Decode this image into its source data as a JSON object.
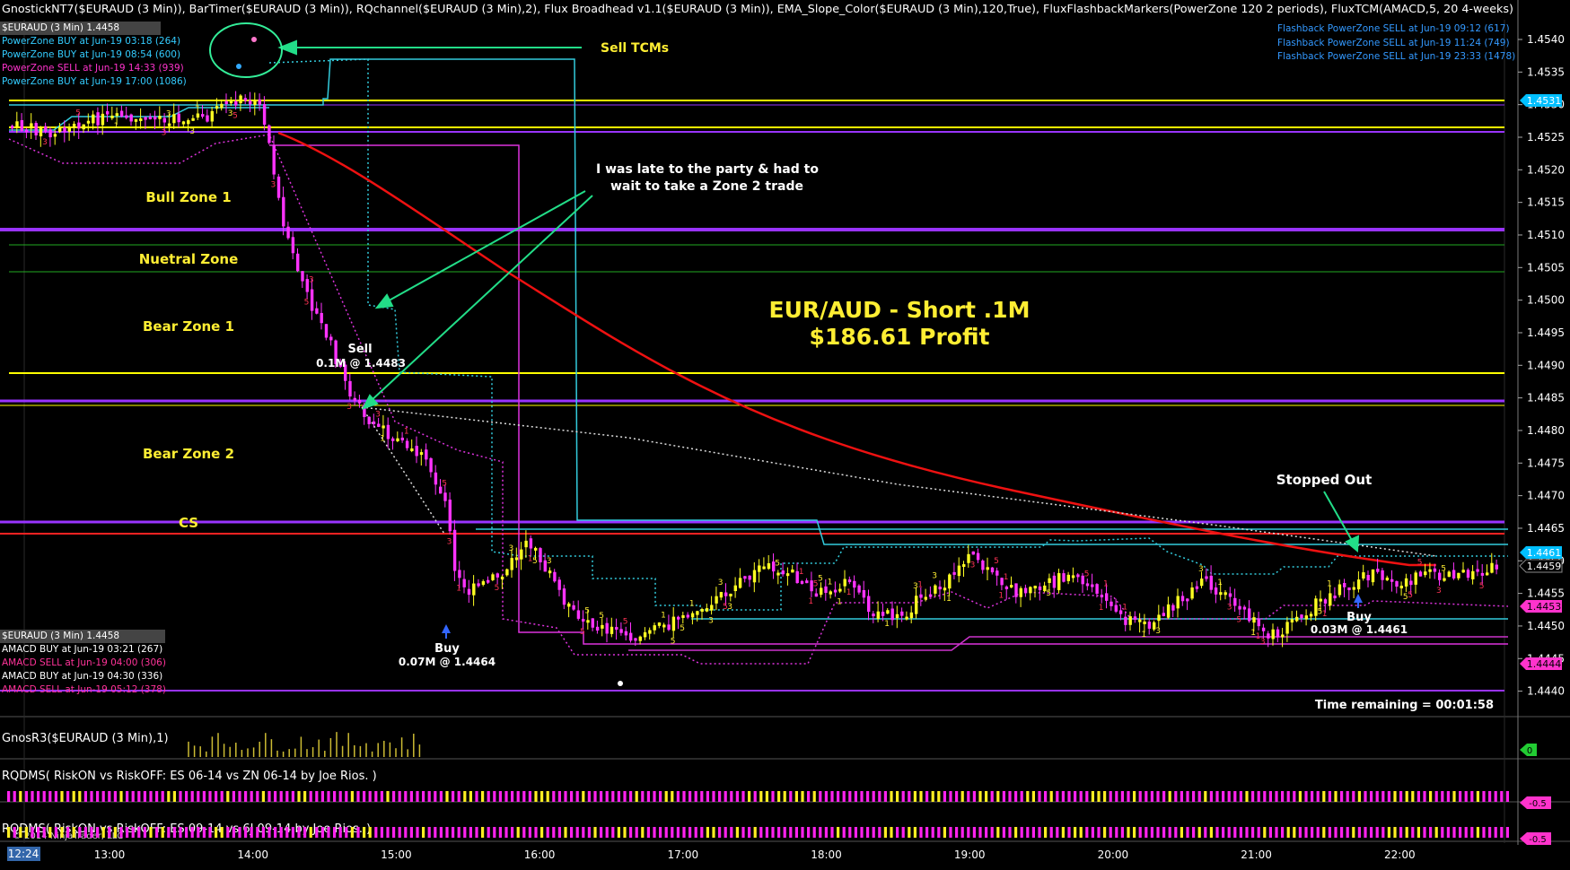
{
  "header": {
    "indicator_line": "GnostickNT7($EURAUD (3 Min)), BarTimer($EURAUD (3 Min)), RQchannel($EURAUD (3 Min),2), Flux Broadhead v1.1($EURAUD (3 Min)), EMA_Slope_Color($EURAUD (3 Min),120,True), FluxFlashbackMarkers(PowerZone 120 2 periods), FluxTCM(AMACD,5, 20 4-weeks)",
    "instrument": "$EURAUD (3 Min) 1.4458",
    "powerzone_entries": [
      {
        "text": "PowerZone BUY at Jun-19 03:18 (264)",
        "color": "#33ccff"
      },
      {
        "text": "PowerZone BUY at Jun-19 08:54 (600)",
        "color": "#33ccff"
      },
      {
        "text": "PowerZone SELL at Jun-19 14:33 (939)",
        "color": "#ff33cc"
      },
      {
        "text": "PowerZone BUY at Jun-19 17:00 (1086)",
        "color": "#33ccff"
      }
    ],
    "flashback_entries": [
      "Flashback PowerZone SELL at Jun-19 09:12 (617)",
      "Flashback PowerZone SELL at Jun-19 11:24 (749)",
      "Flashback PowerZone SELL at Jun-19 23:33 (1478)"
    ]
  },
  "lower_info": {
    "instrument": "$EURAUD (3 Min) 1.4458",
    "amacd_entries": [
      {
        "text": "AMACD BUY at Jun-19 03:21 (267)",
        "color": "#ffffff"
      },
      {
        "text": "AMACD SELL at Jun-19 04:00 (306)",
        "color": "#ff3399"
      },
      {
        "text": "AMACD BUY at Jun-19 04:30 (336)",
        "color": "#ffffff"
      },
      {
        "text": "AMACD SELL at Jun-19 05:12 (378)",
        "color": "#ff3399"
      }
    ]
  },
  "annotations": {
    "sell_tcms": "Sell TCMs",
    "late_line1": "I was late to the party & had to",
    "late_line2": "wait to take a Zone 2 trade",
    "title_line1": "EUR/AUD - Short .1M",
    "title_line2": "$186.61 Profit",
    "stopped_out": "Stopped Out",
    "sell_label": "Sell",
    "sell_detail": "0.1M @ 1.4483",
    "buy1_label": "Buy",
    "buy1_detail": "0.07M @ 1.4464",
    "buy2_label": "Buy",
    "buy2_detail": "0.03M @ 1.4461",
    "time_remaining": "Time remaining = 00:01:58",
    "copyright": "© 2014 NinjaTrader, LLC"
  },
  "zones": {
    "bull1": "Bull Zone 1",
    "neutral": "Nuetral Zone",
    "bear1": "Bear Zone 1",
    "bear2": "Bear Zone 2",
    "cs": "CS"
  },
  "price_axis": {
    "ticks": [
      "1.4540",
      "1.4535",
      "1.4530",
      "1.4525",
      "1.4520",
      "1.4515",
      "1.4510",
      "1.4505",
      "1.4500",
      "1.4495",
      "1.4490",
      "1.4485",
      "1.4480",
      "1.4475",
      "1.4470",
      "1.4465",
      "1.4460",
      "1.4455",
      "1.4450",
      "1.4445",
      "1.4440"
    ],
    "markers": [
      {
        "text": "1.4531",
        "bg": "#00bfff",
        "fg": "#ffffff"
      },
      {
        "text": "1.4461",
        "bg": "#00bfff",
        "fg": "#ffffff"
      },
      {
        "text": "1.4459",
        "bg": "#000000",
        "fg": "#ffffff"
      },
      {
        "text": "1.4453",
        "bg": "#ff33cc",
        "fg": "#000000"
      },
      {
        "text": "1.4444",
        "bg": "#ff33cc",
        "fg": "#000000"
      }
    ]
  },
  "time_axis": {
    "labels": [
      "13:00",
      "14:00",
      "15:00",
      "16:00",
      "17:00",
      "18:00",
      "19:00",
      "20:00",
      "21:00",
      "22:00"
    ],
    "current_time": "12:24"
  },
  "panels": {
    "gnos_title": "GnosR3($EURAUD (3 Min),1)",
    "gnos_value": "0",
    "rq1_title": "RQDMS( RiskON vs RiskOFF: ES 06-14 vs ZN 06-14  by Joe Rios.  )",
    "rq1_value": "-0.5",
    "rq2_title": "RQDMS( RiskON vs RiskOFF: ES 09-14 vs 6J 09-14  by Joe Rios.  )",
    "rq2_value": "-0.5"
  },
  "chart_data": {
    "type": "candlestick",
    "instrument": "$EURAUD (3 Min)",
    "x_axis_labels": [
      "13:00",
      "14:00",
      "15:00",
      "16:00",
      "17:00",
      "18:00",
      "19:00",
      "20:00",
      "21:00",
      "22:00"
    ],
    "ylim": [
      1.4437,
      1.4543
    ],
    "last_price": 1.4458,
    "horizontal_levels": [
      {
        "name": "Bull Zone 1",
        "price": 1.4511,
        "color": "#9933ff"
      },
      {
        "name": "Bear Zone 1",
        "price": 1.4488,
        "color": "#ffff00"
      },
      {
        "name": "Bear Zone 2",
        "price": 1.4484,
        "color": "#9933ff"
      },
      {
        "name": "CS",
        "price": 1.4466,
        "color": "#9933ff"
      },
      {
        "name": "",
        "price": 1.4531,
        "color": "#ffff00"
      },
      {
        "name": "",
        "price": 1.4526,
        "color": "#ffff00"
      },
      {
        "name": "",
        "price": 1.4465,
        "color": "#ff2222"
      },
      {
        "name": "",
        "price": 1.444,
        "color": "#9933ff"
      }
    ],
    "trades": [
      {
        "side": "Sell",
        "size": "0.1M",
        "price": 1.4483
      },
      {
        "side": "Buy",
        "size": "0.07M",
        "price": 1.4464
      },
      {
        "side": "Buy",
        "size": "0.03M",
        "price": 1.4461
      }
    ]
  }
}
